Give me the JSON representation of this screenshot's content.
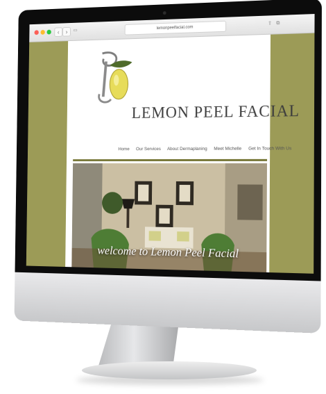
{
  "browser": {
    "url": "lemonpeelfacial.com",
    "back_icon": "chevron-left-icon",
    "forward_icon": "chevron-right-icon",
    "back_label": "‹",
    "forward_label": "›"
  },
  "site": {
    "title": "LEMON PEEL FACIAL",
    "nav": [
      "Home",
      "Our Services",
      "About Dermaplaning",
      "Meet Michelle",
      "Get In Touch With Us"
    ],
    "hero_caption": "welcome to Lemon Peel Facial"
  },
  "colors": {
    "page_background": "#9c9b57",
    "divider": "#7a7a3c",
    "title_text": "#3d3d3d"
  }
}
